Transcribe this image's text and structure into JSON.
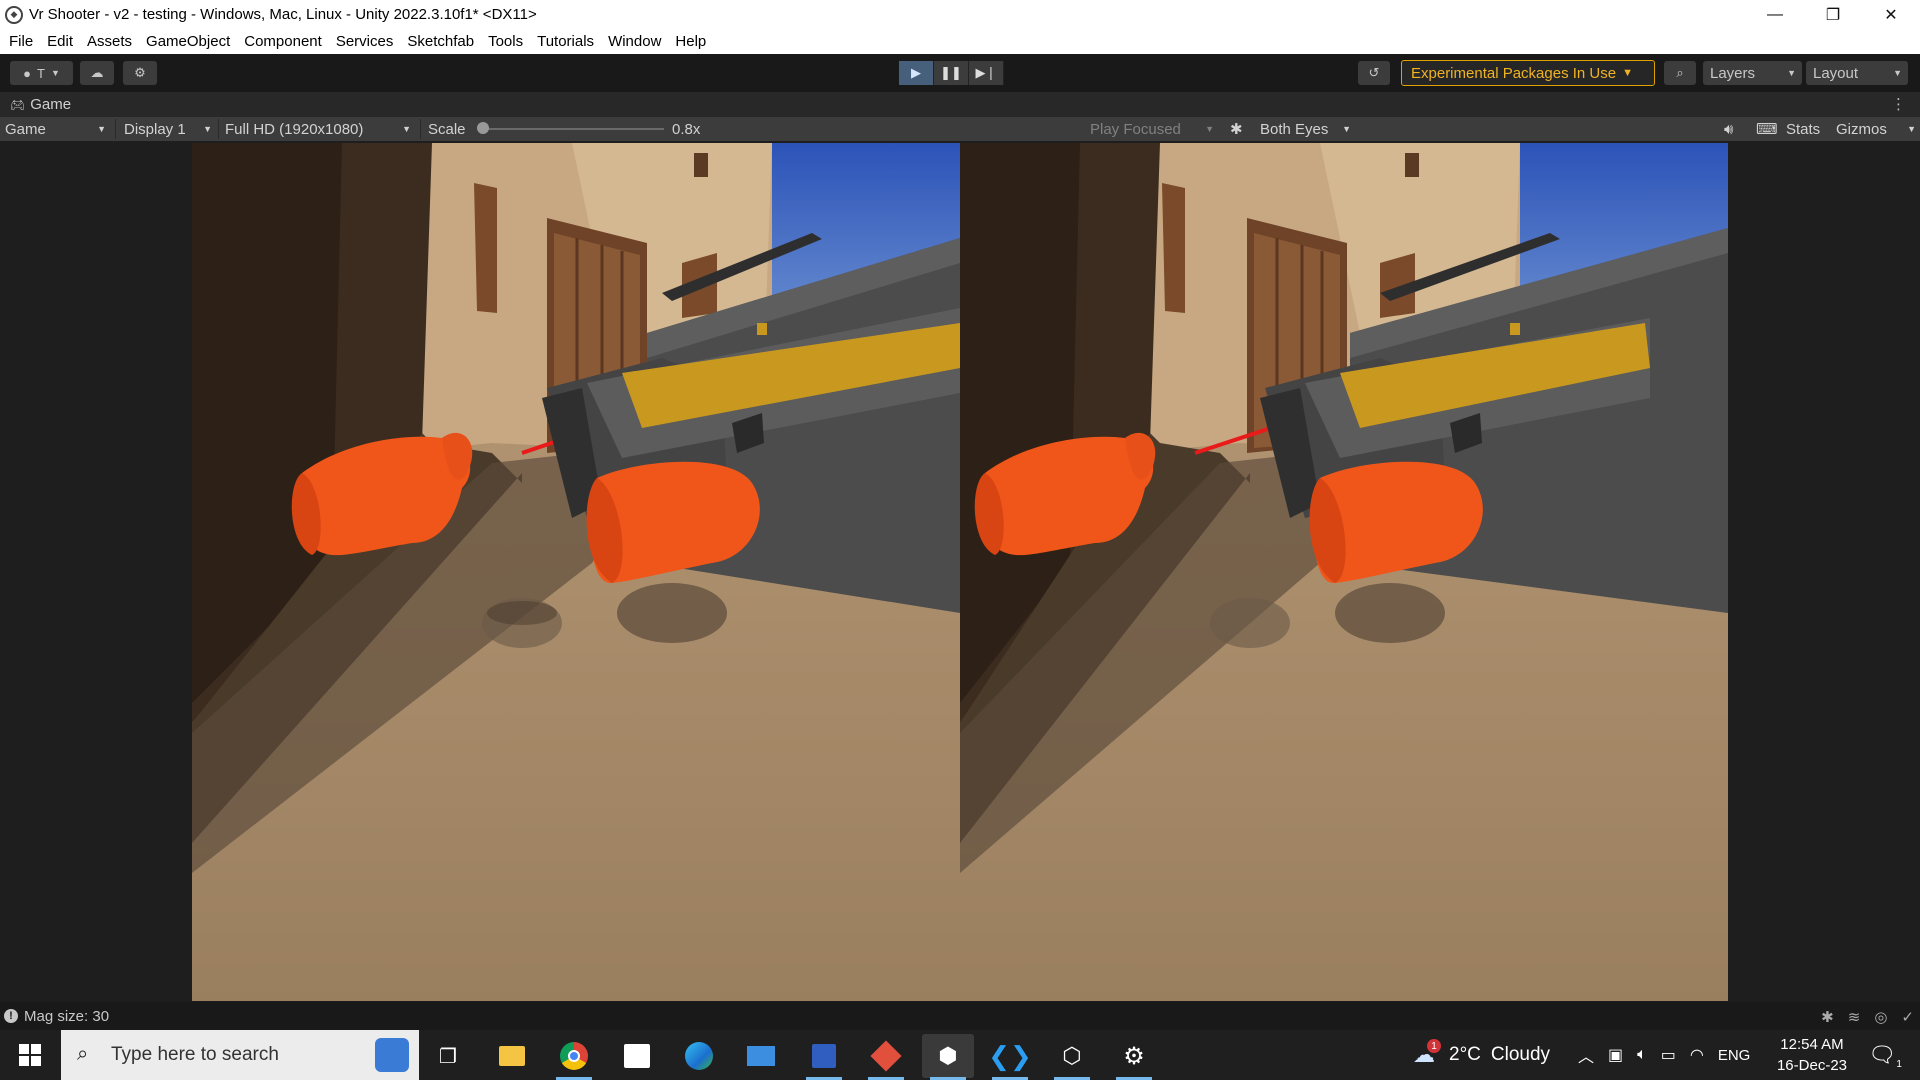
{
  "window": {
    "title": "Vr Shooter - v2 - testing - Windows, Mac, Linux - Unity 2022.3.10f1* <DX11>",
    "minimize_icon": "minimize-icon",
    "restore_icon": "restore-icon",
    "close_icon": "close-icon"
  },
  "menu": [
    "File",
    "Edit",
    "Assets",
    "GameObject",
    "Component",
    "Services",
    "Sketchfab",
    "Tools",
    "Tutorials",
    "Window",
    "Help"
  ],
  "toolbar": {
    "account_initial": "T",
    "experimental_label": "Experimental Packages In Use",
    "layers_label": "Layers",
    "layout_label": "Layout"
  },
  "tab": {
    "title": "Game"
  },
  "game_toolbar": {
    "mode": "Game",
    "display": "Display 1",
    "resolution": "Full HD (1920x1080)",
    "scale_label": "Scale",
    "scale_value": "0.8x",
    "play_focused": "Play Focused",
    "eyes": "Both Eyes",
    "stats": "Stats",
    "gizmos": "Gizmos"
  },
  "status": {
    "message": "Mag size: 30"
  },
  "taskbar": {
    "search_placeholder": "Type here to search",
    "weather_temp": "2°C",
    "weather_desc": "Cloudy",
    "weather_badge": "1",
    "language": "ENG",
    "time": "12:54 AM",
    "date": "16-Dec-23",
    "notification_count": "1"
  },
  "colors": {
    "accent_warning": "#f0b323",
    "play_active": "#46607c",
    "hand": "#f0561a",
    "gun_yellow": "#c9981f",
    "laser": "#e81a1a"
  }
}
